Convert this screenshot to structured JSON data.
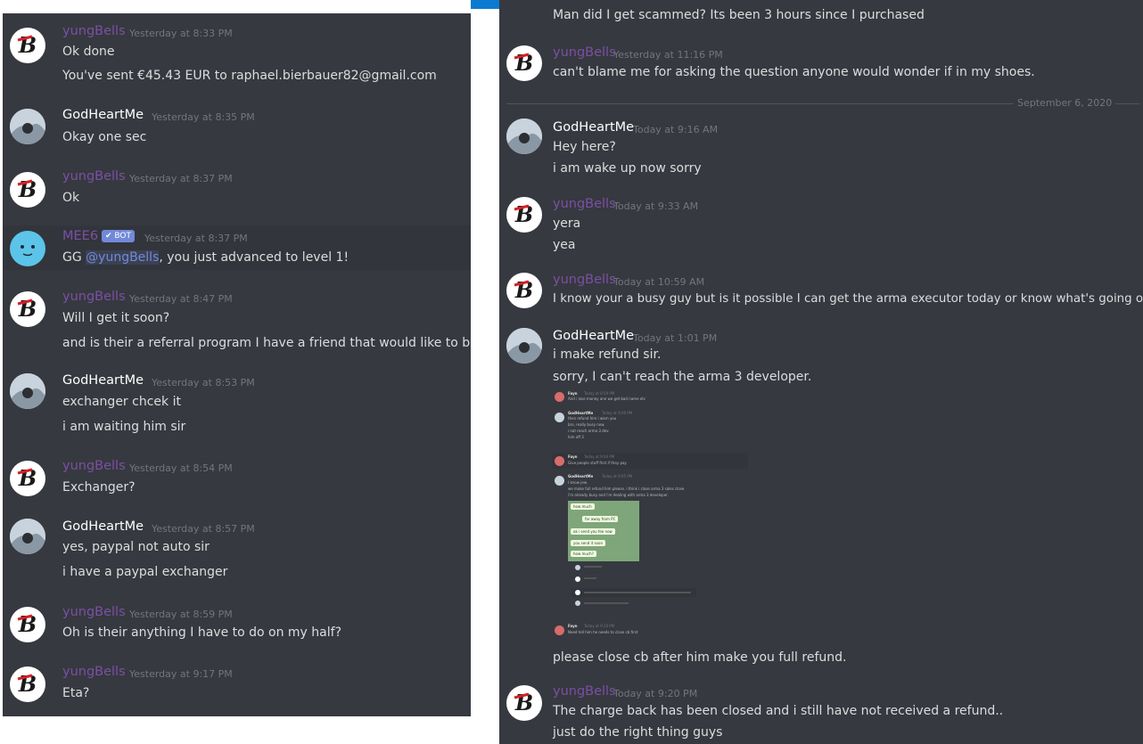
{
  "left": {
    "messages": [
      {
        "author": "yungBells",
        "timestamp": "Yesterday at 8:33 PM",
        "lines": [
          "Ok done",
          "You've sent €45.43 EUR to raphael.bierbauer82@gmail.com"
        ]
      },
      {
        "author": "GodHeartMe",
        "timestamp": "Yesterday at 8:35 PM",
        "lines": [
          "Okay one sec"
        ]
      },
      {
        "author": "yungBells",
        "timestamp": "Yesterday at 8:37 PM",
        "lines": [
          "Ok"
        ]
      },
      {
        "author": "MEE6",
        "badge": "✔ BOT",
        "timestamp": "Yesterday at 8:37 PM",
        "line_prefix": "GG ",
        "mention": "@yungBells",
        "line_suffix": ", you just advanced to level 1!"
      },
      {
        "author": "yungBells",
        "timestamp": "Yesterday at 8:47 PM",
        "lines": [
          "Will I get it soon?",
          "and is their a referral program I have a friend that would like to bu"
        ]
      },
      {
        "author": "GodHeartMe",
        "timestamp": "Yesterday at 8:53 PM",
        "lines": [
          "exchanger chcek it",
          "i am waiting him sir"
        ]
      },
      {
        "author": "yungBells",
        "timestamp": "Yesterday at 8:54 PM",
        "lines": [
          "Exchanger?"
        ]
      },
      {
        "author": "GodHeartMe",
        "timestamp": "Yesterday at 8:57 PM",
        "lines": [
          "yes, paypal not auto sir",
          "i have a paypal exchanger"
        ]
      },
      {
        "author": "yungBells",
        "timestamp": "Yesterday at 8:59 PM",
        "lines": [
          "Oh is their anything I have to do on my half?"
        ]
      },
      {
        "author": "yungBells",
        "timestamp": "Yesterday at 9:17 PM",
        "lines": [
          "Eta?"
        ]
      }
    ]
  },
  "right": {
    "top_line": "Man did I get scammed? Its been 3 hours since I purchased",
    "messages": [
      {
        "author": "yungBells",
        "timestamp": "Yesterday at 11:16 PM",
        "lines": [
          "can't blame me for asking the question anyone would wonder if in my shoes."
        ]
      },
      {
        "author": "GodHeartMe",
        "timestamp": "Today at 9:16 AM",
        "lines": [
          "Hey here?",
          "i am wake up now sorry"
        ]
      },
      {
        "author": "yungBells",
        "timestamp": "Today at 9:33 AM",
        "lines": [
          "yera",
          "yea"
        ]
      },
      {
        "author": "yungBells",
        "timestamp": "Today at 10:59 AM",
        "lines": [
          "I know your a busy guy but is it possible I can get the arma executor today or know what's going on."
        ]
      },
      {
        "author": "GodHeartMe",
        "timestamp": "Today at 1:01 PM",
        "lines": [
          "i make refund sir.",
          "sorry, I can't reach the arma 3 developer.",
          "please close cb after him make you full refund."
        ]
      },
      {
        "author": "yungBells",
        "timestamp": "Today at 9:20 PM",
        "lines": [
          "The charge back has been closed and i still have not received a refund..",
          "just do the right thing guys"
        ]
      }
    ],
    "date_divider": "September 6, 2020",
    "embed": {
      "items": [
        {
          "author": "Fayn",
          "timestamp": "Today at 8:59 PM",
          "lines": [
            "And i lose money ane we get bad name etc"
          ]
        },
        {
          "author": "GodHeartMe",
          "timestamp": "Today at 9:00 PM",
          "lines": [
            "then refund him i warn you",
            "bro, really busy now.",
            "i not reach arma 3 dev.",
            "him off 3"
          ]
        },
        {
          "author": "Fayn",
          "timestamp": "Today at 9:04 PM",
          "lines": [
            "Give people stuff first if they pay"
          ]
        },
        {
          "author": "GodHeartMe",
          "timestamp": "Today at 9:05 PM",
          "lines": [
            "I know jew.",
            "we make full refund him please. i think i close arma 3 sales close",
            "i'm already busy and i'm dealing with arma 3 developer."
          ]
        },
        {
          "author": "Fayn",
          "timestamp": "Today at 9:10 PM",
          "lines": [
            "Need tell him he needs to close cb first"
          ]
        }
      ],
      "bubbles": [
        "how much",
        "far away from PC",
        "ok i send you fee now",
        "you send it soon",
        "how much?"
      ]
    }
  },
  "colors": {
    "panel": "#36393f",
    "purple_name": "#7b4fa4",
    "mention": "#7289da",
    "text": "#dcddde",
    "timestamp": "#72767d",
    "accent_bar": "#0b7ad1"
  }
}
